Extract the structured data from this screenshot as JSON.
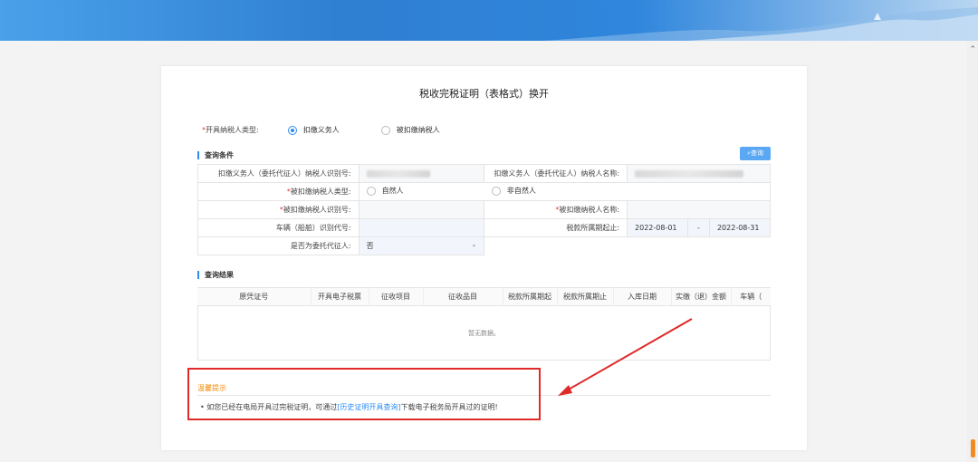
{
  "page": {
    "title": "税收完税证明（表格式）换开",
    "type_row": {
      "required_mark": "*",
      "label": "开具纳税人类型:",
      "options": [
        {
          "label": "扣缴义务人",
          "selected": true
        },
        {
          "label": "被扣缴纳税人",
          "selected": false
        }
      ]
    },
    "query_section": {
      "title": "查询条件",
      "query_button": "查询",
      "fields": {
        "agent_id_label": "扣缴义务人（委托代征人）纳税人识别号:",
        "agent_name_label": "扣缴义务人（委托代征人）纳税人名称:",
        "withheld_type_label": "被扣缴纳税人类型:",
        "withheld_type_options": [
          "自然人",
          "非自然人"
        ],
        "withheld_id_label": "被扣缴纳税人识别号:",
        "withheld_name_label": "被扣缴纳税人名称:",
        "vehicle_label": "车辆（船舶）识别代号:",
        "period_label": "税款所属期起止:",
        "period_start": "2022-08-01",
        "period_sep": "-",
        "period_end": "2022-08-31",
        "is_agent_label": "是否为委托代征人:",
        "is_agent_value": "否"
      },
      "required_mark": "*"
    },
    "result_section": {
      "title": "查询结果",
      "columns": [
        "原凭证号",
        "开具电子税票",
        "征收项目",
        "征收品目",
        "税款所属期起",
        "税款所属期止",
        "入库日期",
        "实缴（退）金额",
        "车辆（"
      ],
      "empty_text": "暂无数据。"
    },
    "tips": {
      "title": "温馨提示",
      "bullet": "•",
      "text_before": "如您已经在电局开具过完税证明，可通过",
      "link": "[历史证明开具查询]",
      "text_after": "下载电子税务局开具过的证明!"
    }
  },
  "colors": {
    "accent": "#2d8cf0",
    "required": "#e23c3c",
    "annotation": "#e02a2a",
    "tips_title": "#f08a00"
  }
}
